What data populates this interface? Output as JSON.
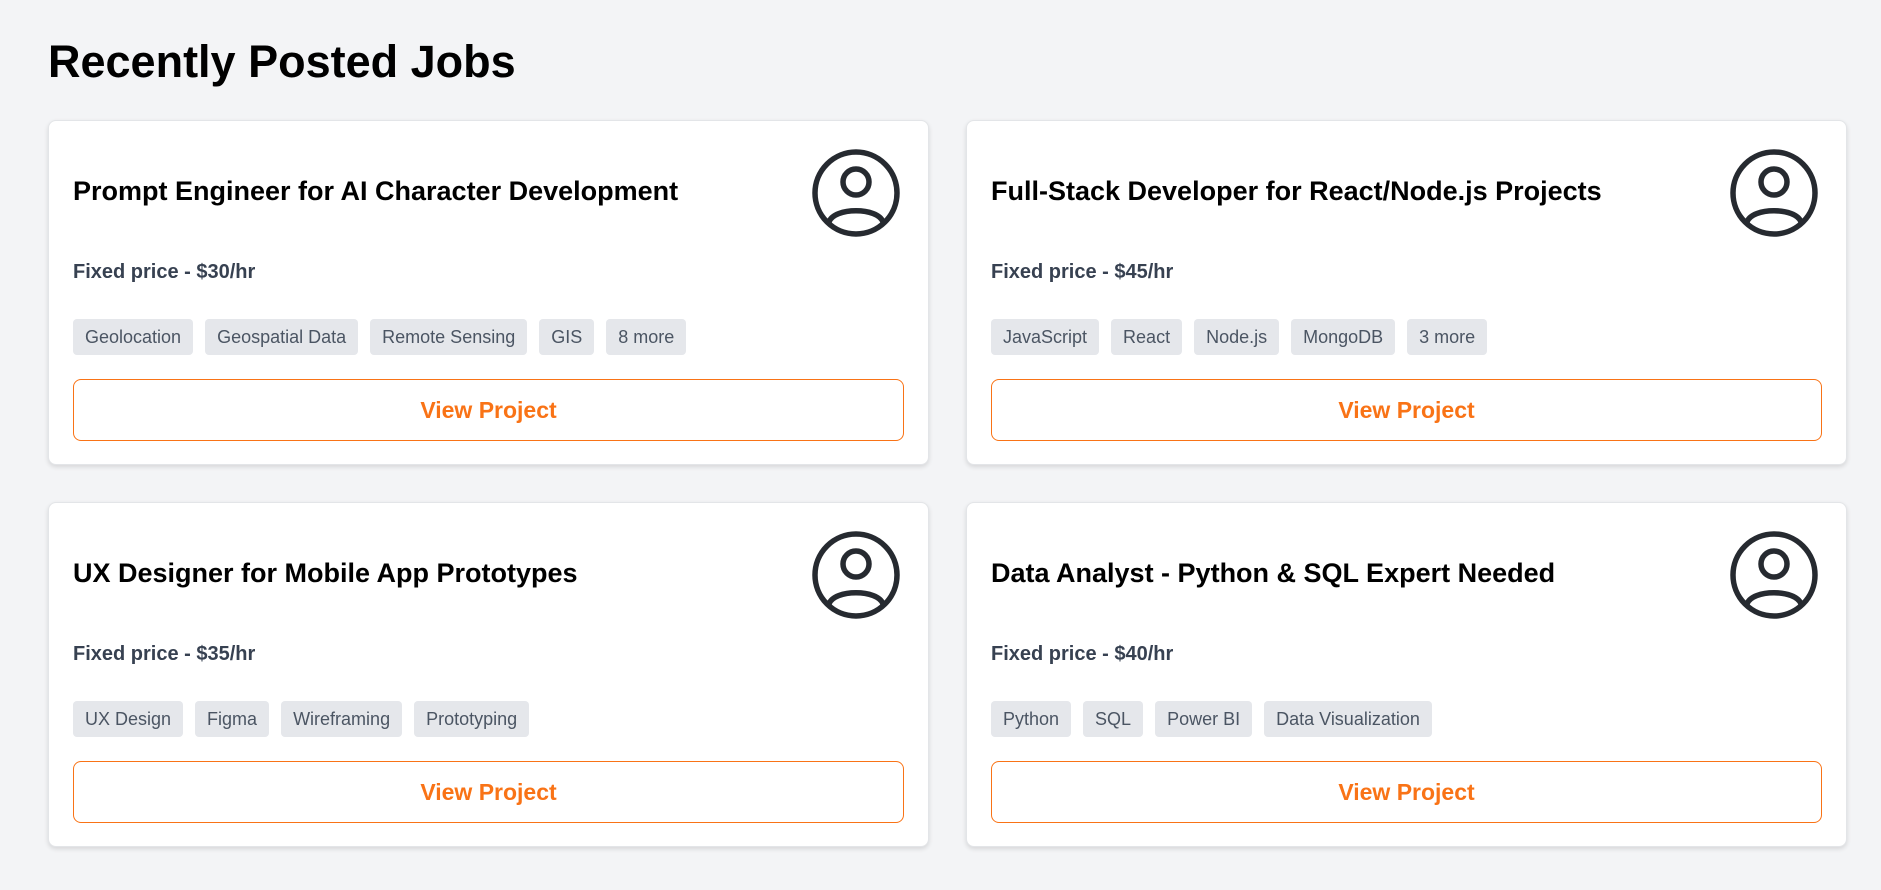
{
  "page": {
    "title": "Recently Posted Jobs"
  },
  "theme": {
    "accent": "#f97316",
    "background": "#f3f4f6",
    "card_bg": "#ffffff",
    "tag_bg": "#e5e7eb",
    "price_color": "#374151",
    "avatar_icon": "user-circle-icon"
  },
  "jobs": [
    {
      "title": "Prompt Engineer for AI Character Development",
      "price": "Fixed price - $30/hr",
      "tags": [
        "Geolocation",
        "Geospatial Data",
        "Remote Sensing",
        "GIS",
        "8 more"
      ],
      "button_label": "View Project"
    },
    {
      "title": "Full-Stack Developer for React/Node.js Projects",
      "price": "Fixed price - $45/hr",
      "tags": [
        "JavaScript",
        "React",
        "Node.js",
        "MongoDB",
        "3 more"
      ],
      "button_label": "View Project"
    },
    {
      "title": "UX Designer for Mobile App Prototypes",
      "price": "Fixed price - $35/hr",
      "tags": [
        "UX Design",
        "Figma",
        "Wireframing",
        "Prototyping"
      ],
      "button_label": "View Project"
    },
    {
      "title": "Data Analyst - Python & SQL Expert Needed",
      "price": "Fixed price - $40/hr",
      "tags": [
        "Python",
        "SQL",
        "Power BI",
        "Data Visualization"
      ],
      "button_label": "View Project"
    }
  ]
}
